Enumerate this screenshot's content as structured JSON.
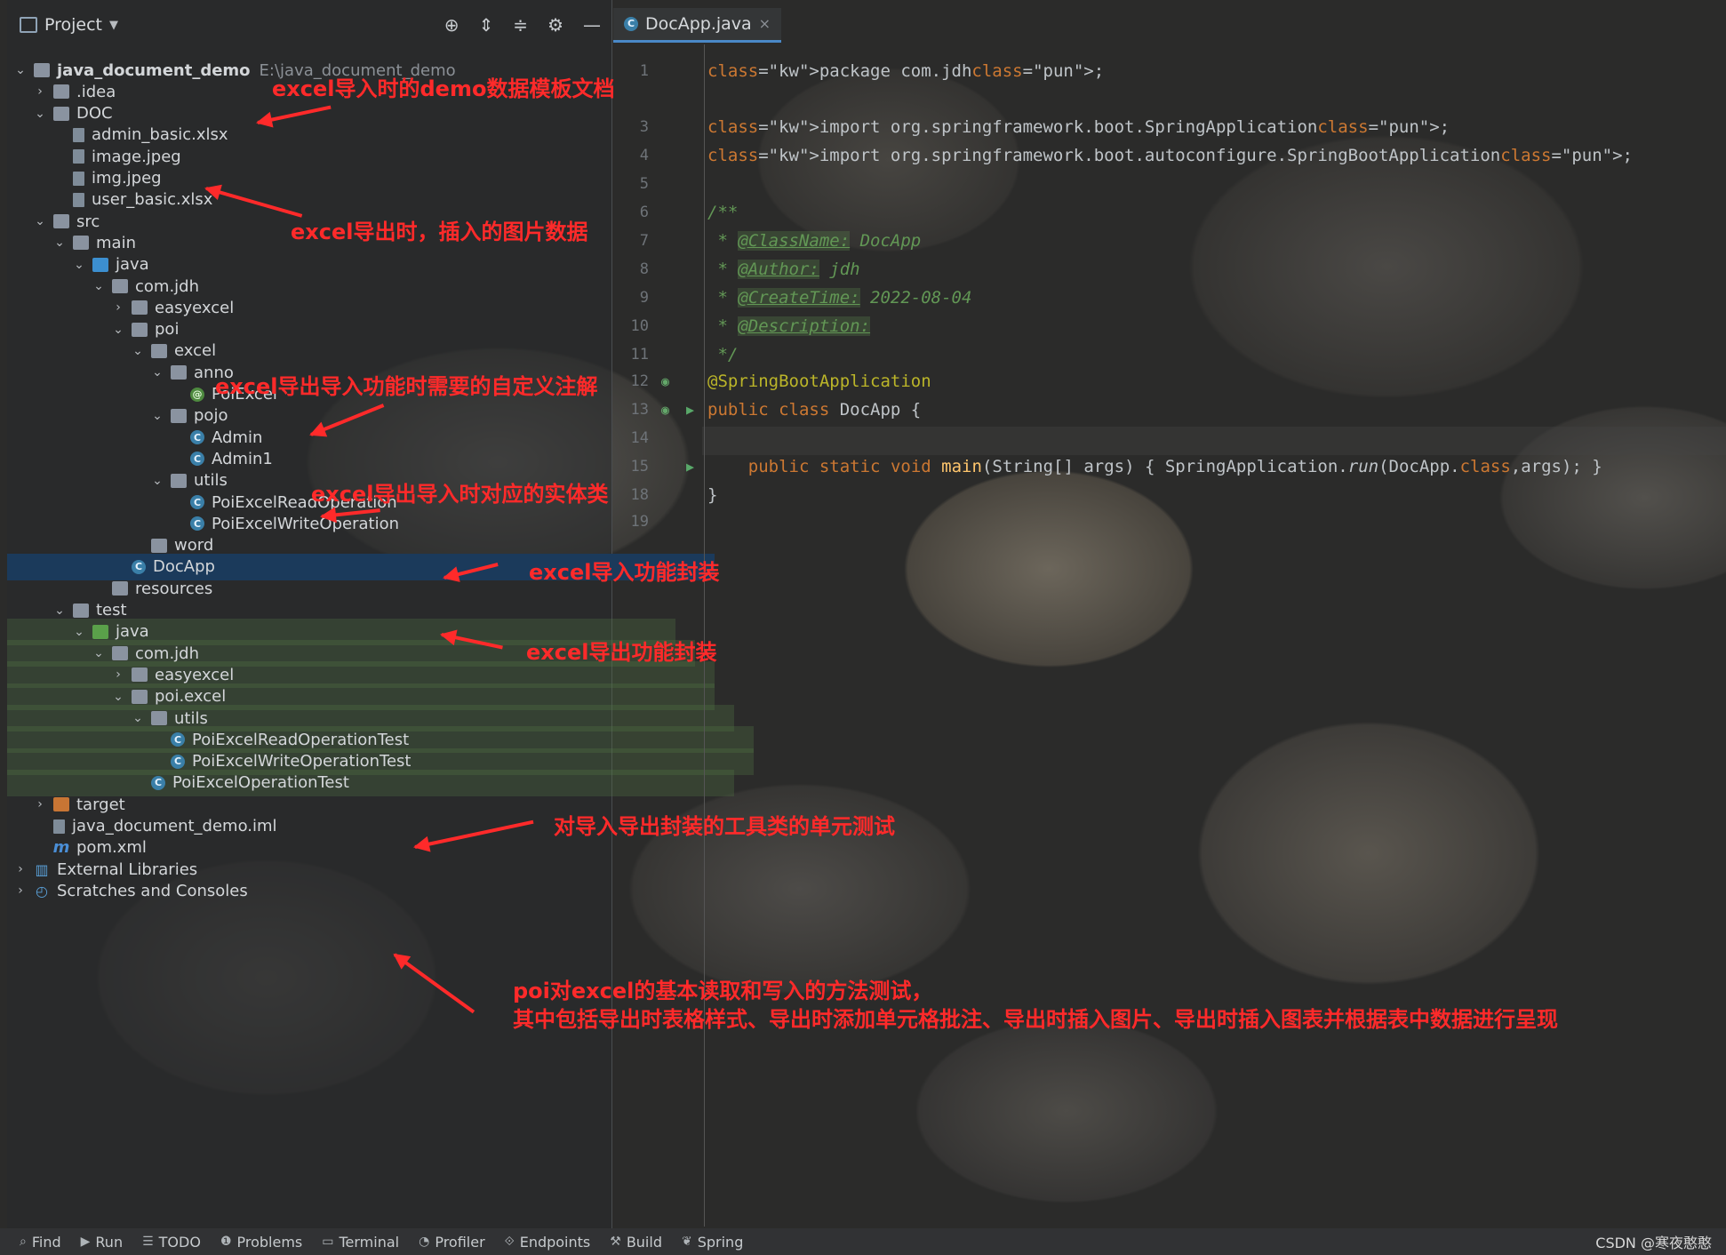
{
  "project_panel": {
    "title": "Project",
    "tree": [
      {
        "label": "java_document_demo",
        "hint": "E:\\java_document_demo",
        "icon": "module-folder-icon",
        "chevron": "down"
      },
      {
        "label": ".idea",
        "icon": "folder-icon",
        "chevron": "right"
      },
      {
        "label": "DOC",
        "icon": "folder-icon",
        "chevron": "down"
      },
      {
        "label": "admin_basic.xlsx",
        "icon": "excel-file-icon"
      },
      {
        "label": "image.jpeg",
        "icon": "image-file-icon"
      },
      {
        "label": "img.jpeg",
        "icon": "image-file-icon"
      },
      {
        "label": "user_basic.xlsx",
        "icon": "excel-file-icon"
      },
      {
        "label": "src",
        "icon": "folder-icon",
        "chevron": "down"
      },
      {
        "label": "main",
        "icon": "folder-icon",
        "chevron": "down"
      },
      {
        "label": "java",
        "icon": "source-folder-icon",
        "chevron": "down"
      },
      {
        "label": "com.jdh",
        "icon": "package-icon",
        "chevron": "down"
      },
      {
        "label": "easyexcel",
        "icon": "package-icon",
        "chevron": "right"
      },
      {
        "label": "poi",
        "icon": "package-icon",
        "chevron": "down"
      },
      {
        "label": "excel",
        "icon": "package-icon",
        "chevron": "down"
      },
      {
        "label": "anno",
        "icon": "package-icon",
        "chevron": "down"
      },
      {
        "label": "PoiExcel",
        "icon": "annotation-icon"
      },
      {
        "label": "pojo",
        "icon": "package-icon",
        "chevron": "down"
      },
      {
        "label": "Admin",
        "icon": "class-icon"
      },
      {
        "label": "Admin1",
        "icon": "class-icon"
      },
      {
        "label": "utils",
        "icon": "package-icon",
        "chevron": "down"
      },
      {
        "label": "PoiExcelReadOperation",
        "icon": "class-icon"
      },
      {
        "label": "PoiExcelWriteOperation",
        "icon": "class-icon"
      },
      {
        "label": "word",
        "icon": "package-icon"
      },
      {
        "label": "DocApp",
        "icon": "spring-class-icon"
      },
      {
        "label": "resources",
        "icon": "resources-folder-icon"
      },
      {
        "label": "test",
        "icon": "folder-icon",
        "chevron": "down"
      },
      {
        "label": "java",
        "icon": "test-folder-icon",
        "chevron": "down"
      },
      {
        "label": "com.jdh",
        "icon": "package-icon",
        "chevron": "down"
      },
      {
        "label": "easyexcel",
        "icon": "package-icon",
        "chevron": "right"
      },
      {
        "label": "poi.excel",
        "icon": "package-icon",
        "chevron": "down"
      },
      {
        "label": "utils",
        "icon": "package-icon",
        "chevron": "down"
      },
      {
        "label": "PoiExcelReadOperationTest",
        "icon": "test-class-icon"
      },
      {
        "label": "PoiExcelWriteOperationTest",
        "icon": "test-class-icon"
      },
      {
        "label": "PoiExcelOperationTest",
        "icon": "test-class-icon"
      },
      {
        "label": "target",
        "icon": "excluded-folder-icon",
        "chevron": "right"
      },
      {
        "label": "java_document_demo.iml",
        "icon": "iml-file-icon"
      },
      {
        "label": "pom.xml",
        "icon": "maven-icon"
      },
      {
        "label": "External Libraries",
        "icon": "libraries-icon",
        "chevron": "right"
      },
      {
        "label": "Scratches and Consoles",
        "icon": "scratches-icon",
        "chevron": "right"
      }
    ]
  },
  "editor": {
    "tab": "DocApp.java",
    "lines": [
      {
        "n": "1",
        "text": "package com.jdh;"
      },
      {
        "n": "3",
        "text": "import org.springframework.boot.SpringApplication;"
      },
      {
        "n": "4",
        "text": "import org.springframework.boot.autoconfigure.SpringBootApplication;"
      },
      {
        "n": "5",
        "text": ""
      },
      {
        "n": "6",
        "text": "/**"
      },
      {
        "n": "7",
        "text": " * @ClassName: DocApp"
      },
      {
        "n": "8",
        "text": " * @Author: jdh"
      },
      {
        "n": "9",
        "text": " * @CreateTime: 2022-08-04"
      },
      {
        "n": "10",
        "text": " * @Description:"
      },
      {
        "n": "11",
        "text": " */"
      },
      {
        "n": "12",
        "text": "@SpringBootApplication"
      },
      {
        "n": "13",
        "text": "public class DocApp {"
      },
      {
        "n": "14",
        "text": ""
      },
      {
        "n": "15",
        "text": "    public static void main(String[] args) { SpringApplication.run(DocApp.class,args); }"
      },
      {
        "n": "18",
        "text": "}"
      },
      {
        "n": "19",
        "text": ""
      }
    ]
  },
  "callouts": [
    "excel导入时的demo数据模板文档",
    "excel导出时，插入的图片数据",
    "excel导出导入功能时需要的自定义注解",
    "excel导出导入时对应的实体类",
    "excel导入功能封装",
    "excel导出功能封装",
    "对导入导出封装的工具类的单元测试",
    "poi对excel的基本读取和写入的方法测试，",
    "其中包括导出时表格样式、导出时添加单元格批注、导出时插入图片、导出时插入图表并根据表中数据进行呈现"
  ],
  "status_bar": {
    "items": [
      "Find",
      "Run",
      "TODO",
      "Problems",
      "Terminal",
      "Profiler",
      "Endpoints",
      "Build",
      "Spring"
    ],
    "watermark": "CSDN @寒夜憨憨"
  },
  "colors": {
    "callout": "#ff2a2a",
    "selection": "#1b3a5b",
    "keyword": "#cc7832",
    "annotation": "#bbb529",
    "doc_comment": "#629755"
  }
}
